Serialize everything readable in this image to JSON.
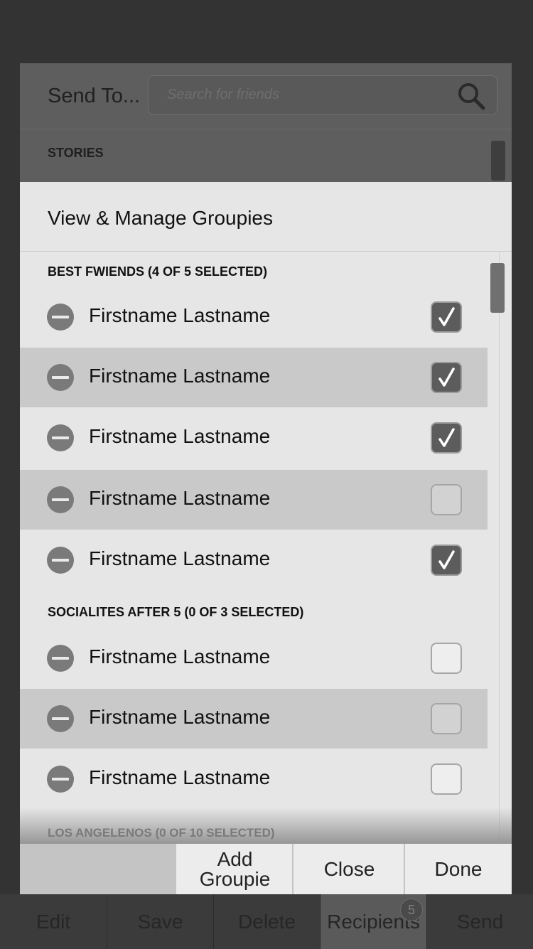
{
  "background": {
    "title": "Send To...",
    "search_placeholder": "Search for friends",
    "section_label": "STORIES"
  },
  "modal": {
    "title": "View & Manage Groupies",
    "groups": [
      {
        "header": "BEST FWIENDS (4 OF 5 SELECTED)",
        "members": [
          {
            "name": "Firstname Lastname",
            "checked": true
          },
          {
            "name": "Firstname Lastname",
            "checked": true
          },
          {
            "name": "Firstname Lastname",
            "checked": true
          },
          {
            "name": "Firstname Lastname",
            "checked": false
          },
          {
            "name": "Firstname Lastname",
            "checked": true
          }
        ]
      },
      {
        "header": "SOCIALITES AFTER 5 (0 OF 3 SELECTED)",
        "members": [
          {
            "name": "Firstname Lastname",
            "checked": false
          },
          {
            "name": "Firstname Lastname",
            "checked": false
          },
          {
            "name": "Firstname Lastname",
            "checked": false
          }
        ]
      },
      {
        "header": "LOS ANGELENOS (0 OF 10 SELECTED)",
        "members": []
      }
    ],
    "actions": {
      "add_groupie": "Add Groupie",
      "close": "Close",
      "done": "Done"
    }
  },
  "bottom_nav": {
    "tabs": [
      "Edit",
      "Save",
      "Delete",
      "Recipients",
      "Send"
    ],
    "active": "Recipients",
    "recipients_badge": "5"
  },
  "icons": {
    "search": "search-icon",
    "remove": "minus-circle-icon",
    "check": "checkmark-icon"
  }
}
